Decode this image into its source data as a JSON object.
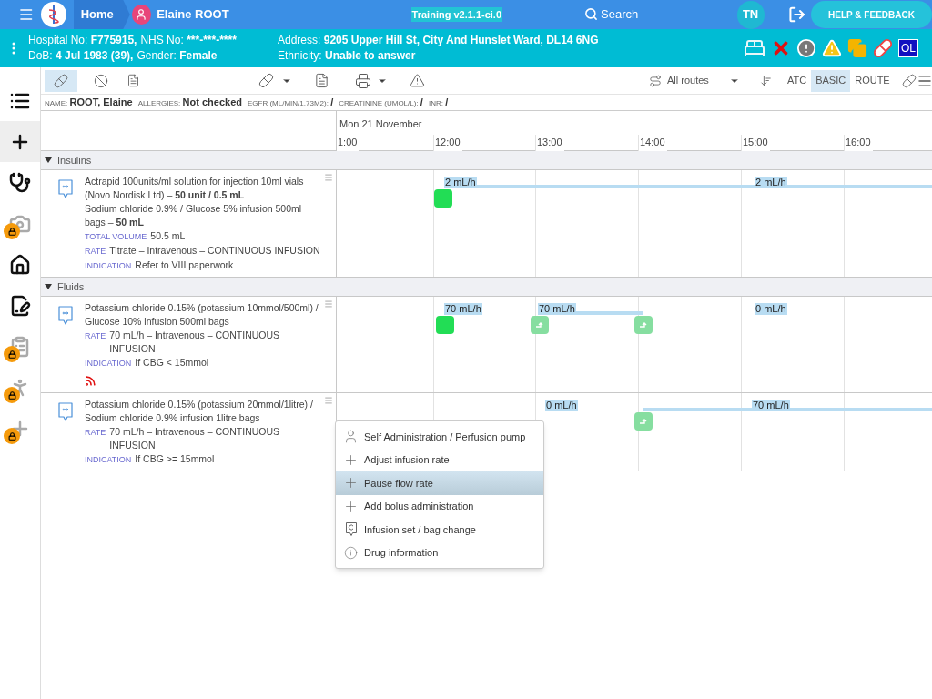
{
  "header": {
    "home": "Home",
    "patient": "Elaine ROOT",
    "version": "Training v2.1.1-ci.0",
    "search": "Search",
    "avatar": "TN",
    "help": "HELP & FEEDBACK"
  },
  "banner": {
    "rows": [
      [
        {
          "label": "Hospital No:",
          "value": "F775915,"
        },
        {
          "label": "NHS No:",
          "value": "***-***-****"
        }
      ],
      [
        {
          "label": "DoB:",
          "value": "4 Jul 1983 (39),"
        },
        {
          "label": "Gender:",
          "value": "Female"
        }
      ]
    ],
    "rows2": [
      [
        {
          "label": "Address:",
          "value": "9205 Upper Hill St, City And Hunslet Ward, DL14 6NG"
        }
      ],
      [
        {
          "label": "Ethnicity:",
          "value": "Unable to answer"
        }
      ]
    ],
    "badge": "OL"
  },
  "sidebar": [
    {
      "selected": false,
      "locked": false
    },
    {
      "selected": true,
      "locked": false
    },
    {
      "selected": false,
      "locked": false
    },
    {
      "selected": false,
      "locked": true
    },
    {
      "selected": false,
      "locked": false
    },
    {
      "selected": false,
      "locked": false
    },
    {
      "selected": false,
      "locked": true
    },
    {
      "selected": false,
      "locked": true
    },
    {
      "selected": false,
      "locked": true
    }
  ],
  "toolbar": {
    "routes": "All routes",
    "views": [
      {
        "label": "ATC",
        "selected": false
      },
      {
        "label": "BASIC",
        "selected": true
      },
      {
        "label": "ROUTE",
        "selected": false
      }
    ]
  },
  "info": [
    {
      "label": "NAME:",
      "value": "ROOT, Elaine"
    },
    {
      "label": "ALLERGIES:",
      "value": "Not checked"
    },
    {
      "label": "EGFR (ML/MIN/1.73M2):",
      "value": "/"
    },
    {
      "label": "CREATININE (UMOL/L):",
      "value": "/"
    },
    {
      "label": "INR:",
      "value": "/"
    }
  ],
  "timeline": {
    "date": "Mon 21 November",
    "hours": [
      "1:00",
      "12:00",
      "13:00",
      "14:00",
      "15:00",
      "16:00"
    ]
  },
  "groups": [
    {
      "name": "Insulins",
      "expanded": true,
      "meds": [
        {
          "lines": [
            "Actrapid 100units/ml solution for injection 10ml vials (Novo Nordisk Ltd) – **50 unit / 0.5 mL**",
            "Sodium chloride 0.9% / Glucose 5% infusion 500ml bags – **50 mL**"
          ],
          "fields": [
            {
              "label": "TOTAL VOLUME",
              "value": "50.5 mL"
            },
            {
              "label": "RATE",
              "value": "Titrate – Intravenous – CONTINUOUS INFUSION"
            },
            {
              "label": "INDICATION",
              "value": "Refer to VIII paperwork"
            }
          ],
          "alert": false,
          "rates": [
            "2 mL/h",
            "2 mL/h"
          ],
          "markers": [
            {
              "kind": "start"
            }
          ]
        }
      ]
    },
    {
      "name": "Fluids",
      "expanded": true,
      "meds": [
        {
          "lines": [
            "Potassium chloride 0.15% (potassium 10mmol/500ml) / Glucose 10% infusion 500ml bags"
          ],
          "fields": [
            {
              "label": "RATE",
              "value": "70 mL/h – Intravenous – CONTINUOUS INFUSION"
            },
            {
              "label": "INDICATION",
              "value": "If CBG < 15mmol"
            }
          ],
          "alert": true,
          "rates": [
            "70 mL/h",
            "70 mL/h",
            "0 mL/h"
          ],
          "markers": [
            {
              "kind": "start"
            },
            {
              "kind": "change"
            },
            {
              "kind": "change"
            }
          ]
        },
        {
          "lines": [
            "Potassium chloride 0.15% (potassium 20mmol/1litre) / Sodium chloride 0.9% infusion 1litre bags"
          ],
          "fields": [
            {
              "label": "RATE",
              "value": "70 mL/h – Intravenous – CONTINUOUS INFUSION"
            },
            {
              "label": "INDICATION",
              "value": "If CBG >= 15mmol"
            }
          ],
          "alert": false,
          "rates": [
            "0 mL/h",
            "70 mL/h"
          ],
          "markers": [
            {
              "kind": "change"
            }
          ]
        }
      ]
    }
  ],
  "menu": [
    {
      "kind": "person",
      "label": "Self Administration / Perfusion pump",
      "selected": false
    },
    {
      "kind": "plus",
      "label": "Adjust infusion rate",
      "selected": false
    },
    {
      "kind": "plus",
      "label": "Pause flow rate",
      "selected": true
    },
    {
      "kind": "plus",
      "label": "Add bolus administration",
      "selected": false
    },
    {
      "kind": "bag",
      "label": "Infusion set / bag change",
      "selected": false
    },
    {
      "kind": "info",
      "label": "Drug information",
      "selected": false
    }
  ]
}
